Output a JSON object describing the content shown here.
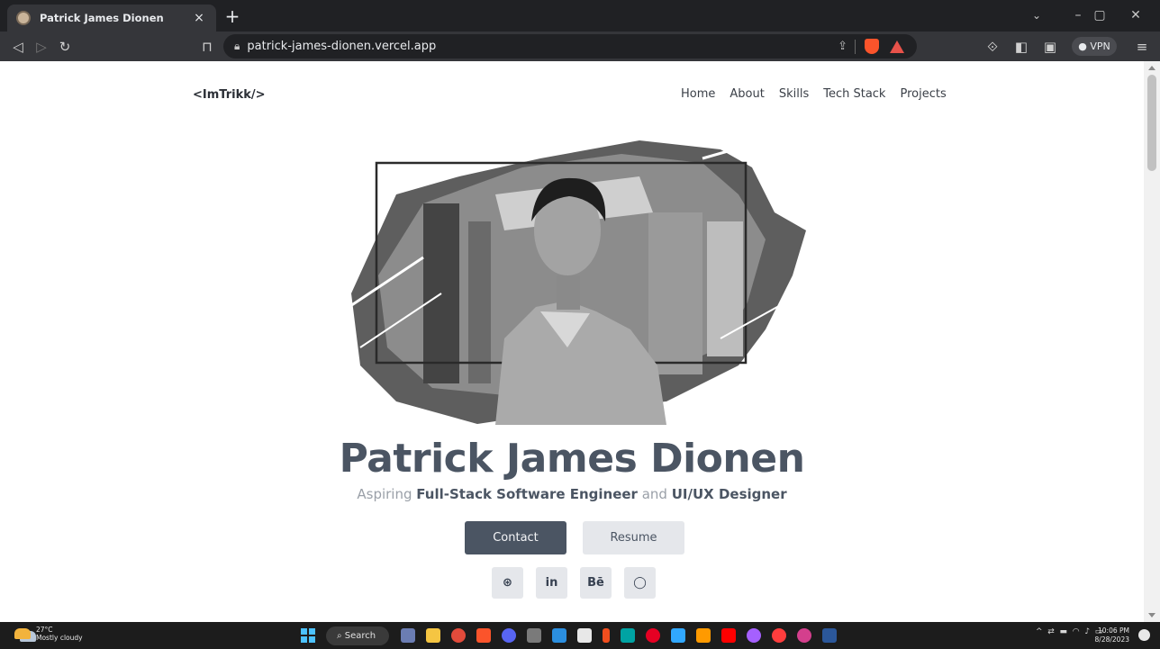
{
  "browser": {
    "tab_title": "Patrick James Dionen",
    "tab_close": "×",
    "new_tab": "+",
    "url": "patrick-james-dionen.vercel.app",
    "vpn_label": "VPN"
  },
  "site": {
    "logo": "<ImTrikk/>",
    "nav": [
      {
        "label": "Home"
      },
      {
        "label": "About"
      },
      {
        "label": "Skills"
      },
      {
        "label": "Tech Stack"
      },
      {
        "label": "Projects"
      }
    ],
    "name": "Patrick James Dionen",
    "tagline": {
      "part1": "Aspiring ",
      "strong1": "Full-Stack Software Engineer",
      "part2": " and ",
      "strong2": "UI/UX Designer"
    },
    "contact_label": "Contact",
    "resume_label": "Resume",
    "socials": [
      {
        "name": "dribbble-icon",
        "glyph": "⊛"
      },
      {
        "name": "linkedin-icon",
        "glyph": "in"
      },
      {
        "name": "behance-icon",
        "glyph": "Bē"
      },
      {
        "name": "github-icon",
        "glyph": "◯"
      }
    ]
  },
  "taskbar": {
    "temp": "27°C",
    "weather": "Mostly cloudy",
    "search_label": "Search",
    "time": "10:06 PM",
    "date": "8/28/2023"
  },
  "colors": {
    "primary": "#4b5563",
    "secondary_btn": "#e5e7eb",
    "browser_dark": "#202124",
    "toolbar": "#35363a"
  }
}
